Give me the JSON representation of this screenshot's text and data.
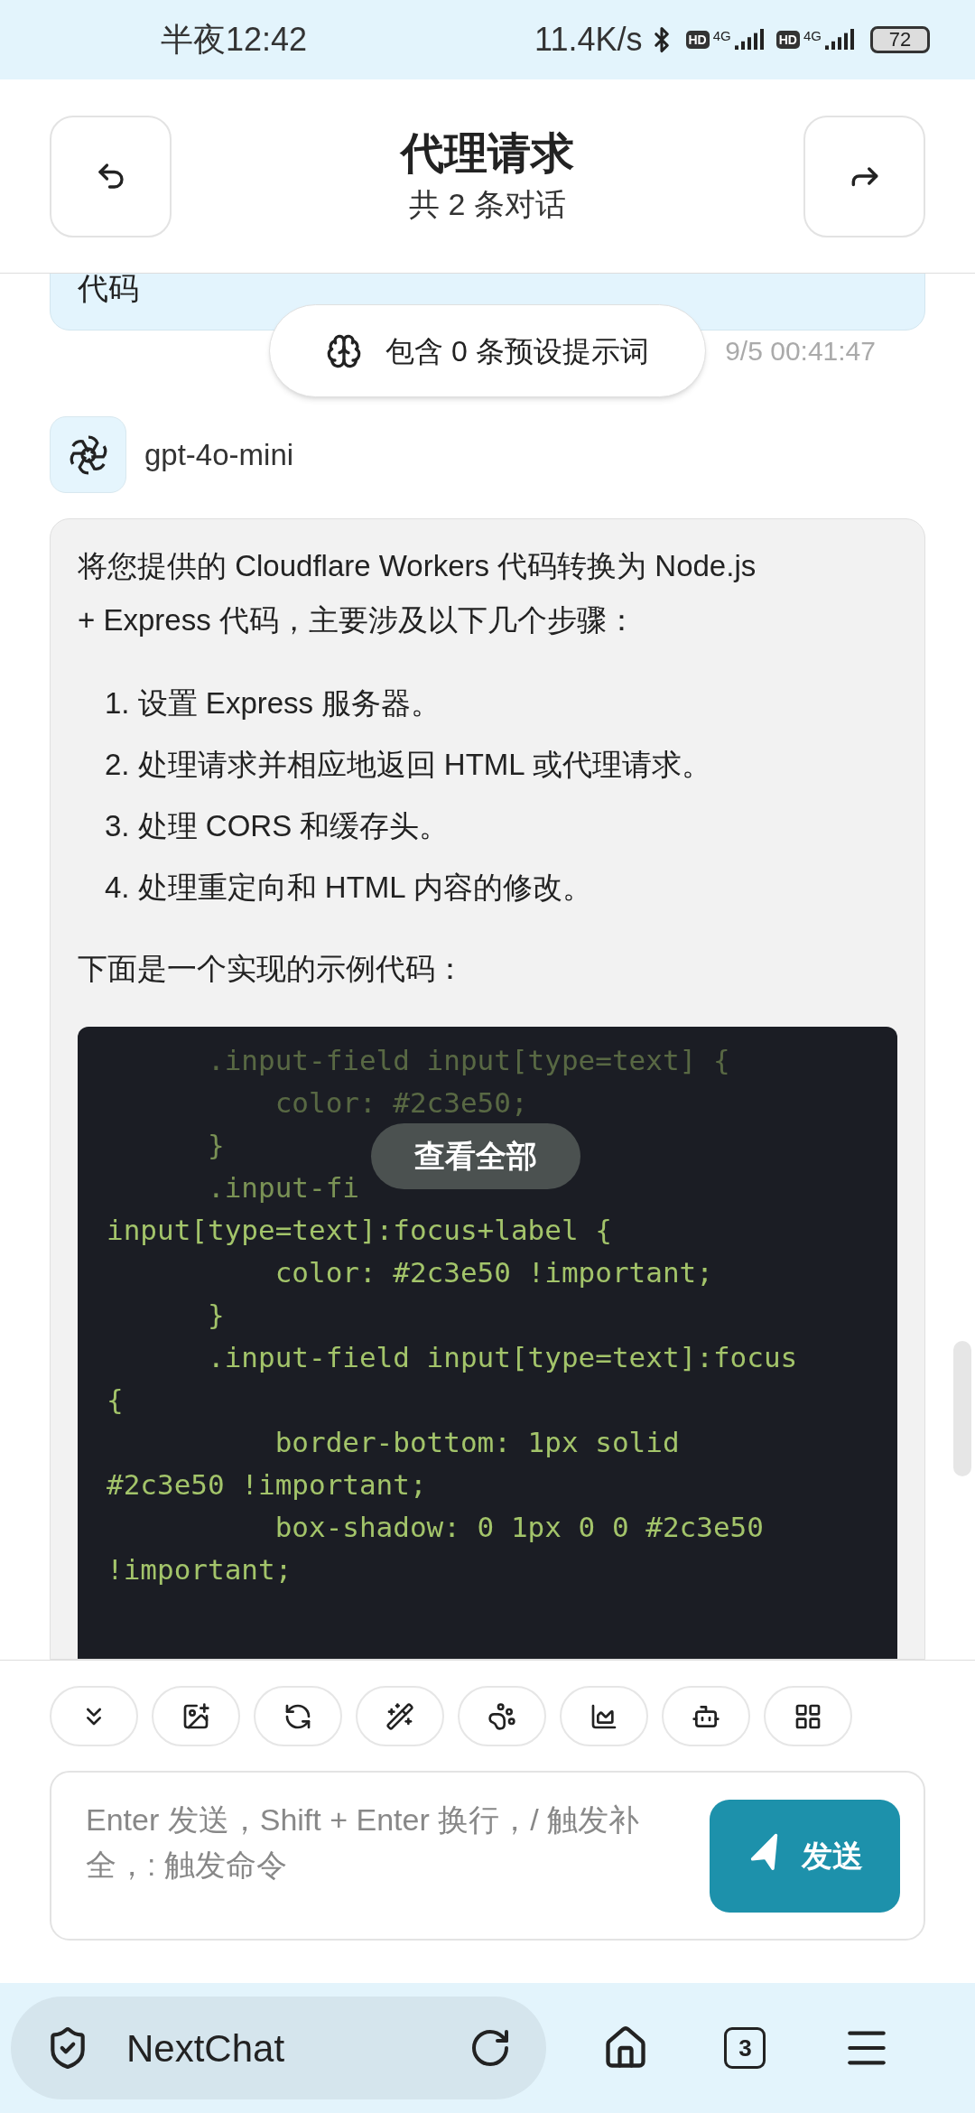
{
  "status_bar": {
    "time": "半夜12:42",
    "speed": "11.4K/s",
    "sims": [
      {
        "hd": "HD",
        "network": "4G"
      },
      {
        "hd": "HD",
        "network": "4G"
      }
    ],
    "battery": "72"
  },
  "header": {
    "title": "代理请求",
    "subtitle": "共 2 条对话"
  },
  "user_message": {
    "text": "代码",
    "time": "9/5 00:41:47"
  },
  "prompt_pill": {
    "label": "包含 0 条预设提示词"
  },
  "assistant": {
    "model": "gpt-4o-mini",
    "intro": "将您提供的 Cloudflare Workers 代码转换为 Node.js + Express 代码，主要涉及以下几个步骤：",
    "steps": [
      {
        "number": "1.",
        "text": "设置 Express 服务器。"
      },
      {
        "number": "2.",
        "text": "处理请求并相应地返回 HTML 或代理请求。"
      },
      {
        "number": "3.",
        "text": "处理 CORS 和缓存头。"
      },
      {
        "number": "4.",
        "text": "处理重定向和 HTML 内容的修改。"
      }
    ],
    "outro": "下面是一个实现的示例代码：",
    "code_lines": [
      "      .input-field input[type=text] {",
      "          color: #2c3e50;",
      "      }",
      "      .input-fi",
      "input[type=text]:focus+label {",
      "          color: #2c3e50 !important;",
      "      }",
      "      .input-field input[type=text]:focus",
      "{",
      "          border-bottom: 1px solid",
      "#2c3e50 !important;",
      "          box-shadow: 0 1px 0 0 #2c3e50",
      "!important;"
    ],
    "expand_button": "查看全部"
  },
  "toolbar": [
    {
      "kind": "scroll"
    },
    {
      "kind": "image"
    },
    {
      "kind": "model"
    },
    {
      "kind": "wand"
    },
    {
      "kind": "mask"
    },
    {
      "kind": "chart"
    },
    {
      "kind": "bot"
    },
    {
      "kind": "grid"
    }
  ],
  "input": {
    "placeholder": "Enter 发送，Shift + Enter 换行，/ 触发补全，: 触发命令",
    "send": "发送"
  },
  "browser_bar": {
    "url": "NextChat",
    "tabs": "3"
  }
}
